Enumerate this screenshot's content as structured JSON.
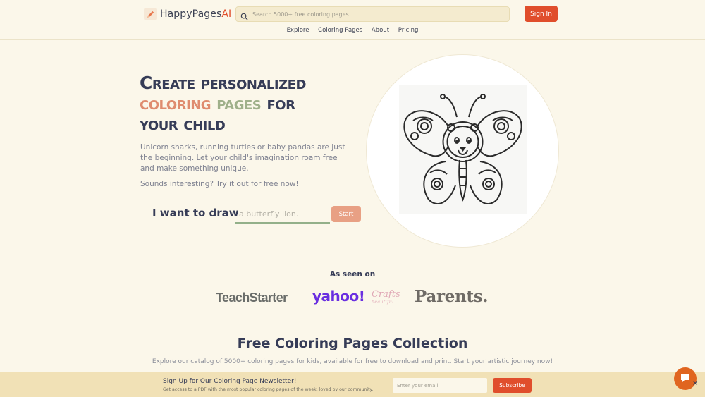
{
  "header": {
    "logo_text": "HappyPages",
    "logo_accent": "AI",
    "search_placeholder": "Search 5000+ free coloring pages",
    "signin_label": "Sign In",
    "nav": [
      "Explore",
      "Coloring Pages",
      "About",
      "Pricing"
    ]
  },
  "hero": {
    "title_line1": "Create personalized",
    "title_word_coloring": "coloring",
    "title_word_pages": "pages",
    "title_word_for": "for",
    "title_line3": "your child",
    "description": "Unicorn sharks, running turtles or baby pandas are just the beginning. Let your child's imagination roam free and make something unique.",
    "cta_text": "Sounds interesting? Try it out for free now!",
    "draw_label": "I want to draw",
    "draw_placeholder": "a butterfly lion.",
    "start_label": "Start",
    "image_subject": "butterfly-lion coloring page"
  },
  "seen_on": {
    "title": "As seen on",
    "logos": {
      "teachstarter": "TeachStarter",
      "yahoo": "yahoo!",
      "crafts": "Crafts",
      "crafts_sub": "beautiful",
      "parents": "Parents."
    }
  },
  "collection": {
    "title": "Free Coloring Pages Collection",
    "description": "Explore our catalog of 5000+ coloring pages for kids, available for free to download and print. Start your artistic journey now!"
  },
  "newsletter": {
    "title": "Sign Up for Our Coloring Page Newsletter!",
    "subtitle": "Get access to a PDF with the most popular coloring pages of the week, loved by our community.",
    "email_placeholder": "Enter your email",
    "subscribe_label": "Subscribe",
    "close_glyph": "✕"
  },
  "colors": {
    "background": "#fbf7ea",
    "accent": "#e04e2c",
    "title_dark": "#363c57",
    "title_peach": "#df8c6f",
    "title_sage": "#9fb08a",
    "newsletter_bar": "#f1e1b6"
  }
}
